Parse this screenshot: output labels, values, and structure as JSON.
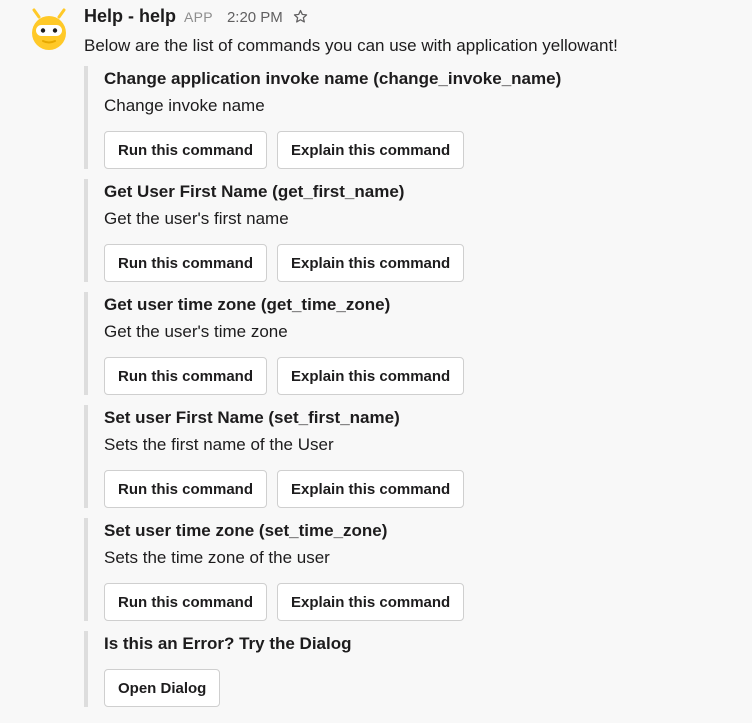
{
  "message": {
    "sender": "Help - help",
    "badge": "APP",
    "time": "2:20 PM",
    "intro": "Below are the list of commands you can use with application yellowant!"
  },
  "attachments": [
    {
      "title": "Change application invoke name (change_invoke_name)",
      "text": "Change invoke name",
      "run_label": "Run this command",
      "explain_label": "Explain this command"
    },
    {
      "title": "Get User First Name (get_first_name)",
      "text": "Get the user's first name",
      "run_label": "Run this command",
      "explain_label": "Explain this command"
    },
    {
      "title": "Get user time zone (get_time_zone)",
      "text": "Get the user's time zone",
      "run_label": "Run this command",
      "explain_label": "Explain this command"
    },
    {
      "title": "Set user First Name (set_first_name)",
      "text": "Sets the first name of the User",
      "run_label": "Run this command",
      "explain_label": "Explain this command"
    },
    {
      "title": "Set user time zone (set_time_zone)",
      "text": "Sets the time zone of the user",
      "run_label": "Run this command",
      "explain_label": "Explain this command"
    }
  ],
  "error_block": {
    "title": "Is this an Error? Try the Dialog",
    "button_label": "Open Dialog"
  },
  "icons": {
    "avatar": "robot-avatar-icon",
    "star": "star-outline-icon"
  },
  "colors": {
    "background": "#f8f8f8",
    "attachment_border": "#dddddd",
    "avatar_yellow": "#ffc928"
  }
}
